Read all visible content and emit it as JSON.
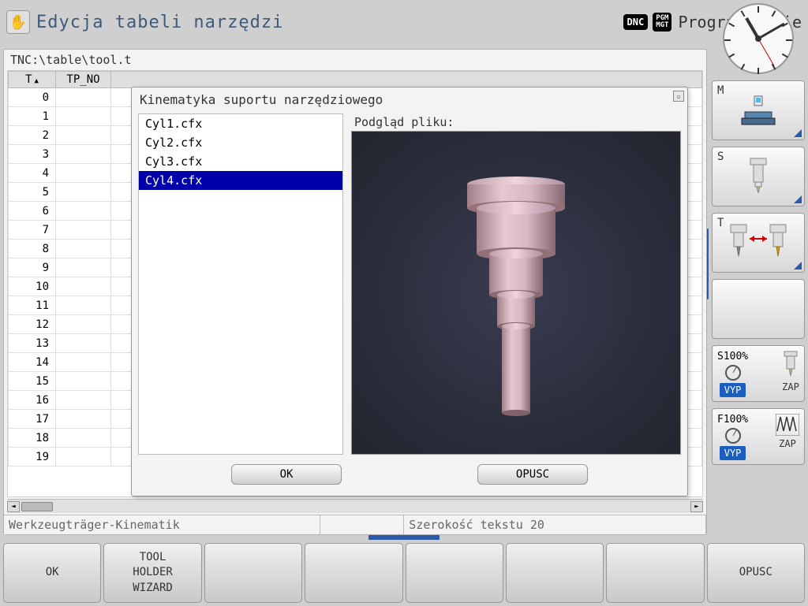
{
  "header": {
    "title": "Edycja tabeli narzędzi",
    "dnc": "DNC",
    "pgm": "PGM\nMGT",
    "mode": "Programowanie"
  },
  "filepath": "TNC:\\table\\tool.t",
  "table": {
    "col_t": "T",
    "col_tp": "TP_NO",
    "rows": [
      0,
      1,
      2,
      3,
      4,
      5,
      6,
      7,
      8,
      9,
      10,
      11,
      12,
      13,
      14,
      15,
      16,
      17,
      18,
      19
    ]
  },
  "dialog": {
    "title": "Kinematyka suportu narzędziowego",
    "preview_label": "Podgląd pliku:",
    "files": [
      "Cyl1.cfx",
      "Cyl2.cfx",
      "Cyl3.cfx",
      "Cyl4.cfx"
    ],
    "selected_index": 3,
    "ok": "OK",
    "cancel": "OPUSC"
  },
  "status": {
    "left": "Werkzeugträger-Kinematik",
    "right": "Szerokość tekstu 20"
  },
  "side": {
    "m": "M",
    "s": "S",
    "t": "T",
    "s100": "S100%",
    "f100": "F100%",
    "vyp": "VYP",
    "zap": "ZAP"
  },
  "softkeys": {
    "k1": "OK",
    "k2": "TOOL\nHOLDER\nWIZARD",
    "k8": "OPUSC"
  }
}
